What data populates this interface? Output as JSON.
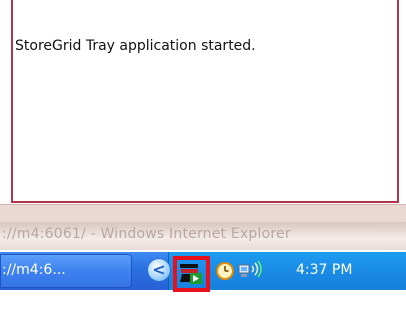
{
  "notification": {
    "message": "StoreGrid Tray application started."
  },
  "background_window": {
    "title": "://m4:6061/ - Windows Internet Explorer"
  },
  "taskbar": {
    "task_button_label": "://m4:6...",
    "show_hidden_icons_glyph": "<",
    "clock": "4:37 PM"
  },
  "tray_icons": {
    "app": "storegrid-tray-icon",
    "clock": "clock-icon",
    "network": "network-icon"
  },
  "colors": {
    "balloon_border": "#b0364d",
    "highlight": "#e8101a",
    "taskbar": "#2a6fe0",
    "tray": "#1a8be6"
  }
}
